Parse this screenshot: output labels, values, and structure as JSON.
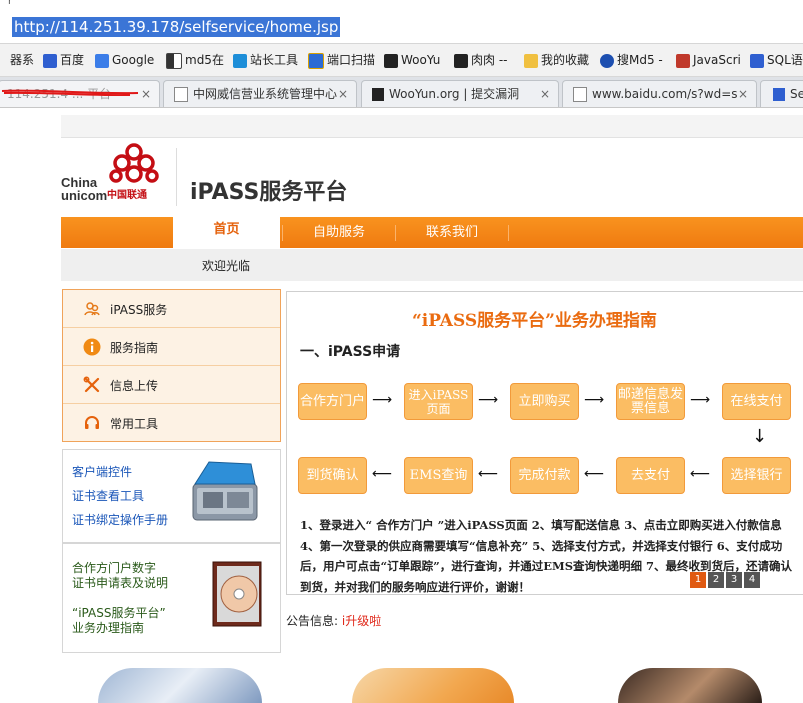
{
  "browser": {
    "url": "http://114.251.39.178/selfservice/home.jsp",
    "bookmarks": [
      {
        "label": "器系",
        "icon": "folder-icon"
      },
      {
        "label": "百度",
        "icon": "baidu-icon"
      },
      {
        "label": "Google",
        "icon": "google-icon"
      },
      {
        "label": "md5在",
        "icon": "md5-icon"
      },
      {
        "label": "站长工具",
        "icon": "chinaz-icon"
      },
      {
        "label": "端口扫描",
        "icon": "port-icon"
      },
      {
        "label": "WooYu",
        "icon": "wooyun-icon"
      },
      {
        "label": "肉肉 --",
        "icon": "wooyun-icon"
      },
      {
        "label": "我的收藏",
        "icon": "folder-icon"
      },
      {
        "label": "搜Md5 -",
        "icon": "md5-search-icon"
      },
      {
        "label": "JavaScri",
        "icon": "w3-icon"
      },
      {
        "label": "SQL语",
        "icon": "baidu-icon"
      }
    ],
    "tabs": [
      {
        "label": "114.251.4 ... 平台",
        "close": "×"
      },
      {
        "label": "中网威信营业系统管理中心",
        "close": "×"
      },
      {
        "label": "WooYun.org | 提交漏洞",
        "close": "×"
      },
      {
        "label": "www.baidu.com/s?wd=s",
        "close": "×"
      },
      {
        "label": "Se",
        "close": ""
      }
    ],
    "colors": {
      "url_highlight": "#3b75d6",
      "redact_scribble": "#e01818"
    }
  },
  "header": {
    "logo_en_line1": "China",
    "logo_en_line2": "unicom",
    "logo_cn": "中国联通",
    "brand_title": "iPASS服务平台",
    "colors": {
      "logo_red": "#c40e14",
      "nav_orange": "#f7861a"
    }
  },
  "nav": {
    "items": [
      "首页",
      "自助服务",
      "联系我们"
    ],
    "active": "首页",
    "welcome": "欢迎光临"
  },
  "left_menu": {
    "items": [
      {
        "label": "iPASS服务",
        "icon": "group-icon"
      },
      {
        "label": "服务指南",
        "icon": "info-icon"
      },
      {
        "label": "信息上传",
        "icon": "tools-icon"
      },
      {
        "label": "常用工具",
        "icon": "headset-icon"
      }
    ]
  },
  "downloads": {
    "links": [
      "客户端控件",
      "证书查看工具",
      "证书绑定操作手册"
    ],
    "image_icon": "toolbox-icon"
  },
  "docs": {
    "link1_line1": "合作方门户数字",
    "link1_line2": "证书申请表及说明",
    "link2_line1": "“iPASS服务平台”",
    "link2_line2": "业务办理指南",
    "image_icon": "cd-case-icon"
  },
  "guide": {
    "title": "“iPASS服务平台”业务办理指南",
    "subtitle": "一、iPASS申请",
    "row1": [
      "合作方门户",
      "进入iPASS页面",
      "立即购买",
      "邮递信息发票信息",
      "在线支付"
    ],
    "row2": [
      "到货确认",
      "EMS查询",
      "完成付款",
      "去支付",
      "选择银行"
    ],
    "description": "1、登录进入“ 合作方门户 ”进入iPASS页面 2、填写配送信息 3、点击立即购买进入付款信息 4、第一次登录的供应商需要填写“信息补充” 5、选择支付方式，并选择支付银行 6、支付成功后，用户可点击“订单跟踪”，进行查询，并通过EMS查询快递明细 7、最终收到货后，还请确认到货，并对我们的服务响应进行评价，谢谢！",
    "pages": [
      "1",
      "2",
      "3",
      "4"
    ],
    "colors": {
      "step_fill": "#fbbd63",
      "title_color": "#ea6b10"
    }
  },
  "notice": {
    "label": "公告信息:",
    "value": "i升级啦"
  }
}
